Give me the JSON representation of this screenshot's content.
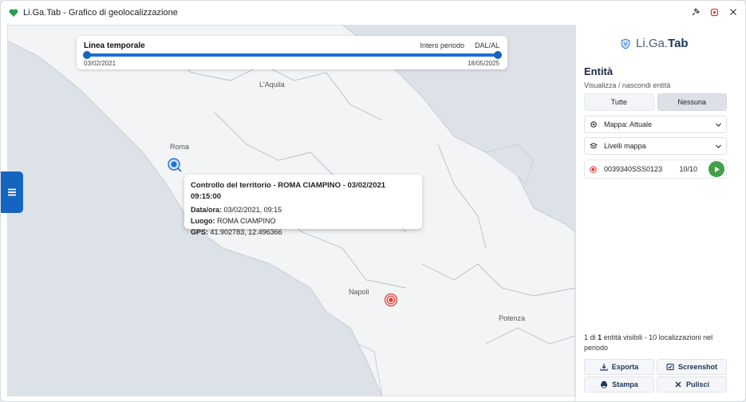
{
  "window": {
    "title": "Li.Ga.Tab - Grafico di geolocalizzazione"
  },
  "colors": {
    "accent": "#1565c0",
    "play": "#43a047",
    "marker_red": "#e53935",
    "map_bg": "#dfe3e8"
  },
  "timeline": {
    "title": "Linea temporale",
    "period_label": "Intero periodo",
    "range_label": "DAL/AL",
    "start_date": "03/02/2021",
    "end_date": "18/05/2025"
  },
  "map": {
    "cities": {
      "aquila": "L'Aquila",
      "roma": "Roma",
      "napoli": "Napoli",
      "potenza": "Potenza"
    },
    "popup": {
      "title": "Controllo del territorio - ROMA CIAMPINO - 03/02/2021 09:15:00",
      "date_label": "Data/ora:",
      "date_value": "03/02/2021, 09:15",
      "place_label": "Luogo:",
      "place_value": "ROMA CIAMPINO",
      "gps_label": "GPS:",
      "gps_value": "41.902783, 12.496366"
    }
  },
  "panel": {
    "logo_light": "Li.Ga.",
    "logo_bold": "Tab",
    "heading": "Entità",
    "subtitle": "Visualizza / nascondi entità",
    "btn_all": "Tutte",
    "btn_none": "Nessuna",
    "map_select": "Mappa: Attuale",
    "layers_select": "Livelli mappa",
    "entity": {
      "id": "0039340SSS0123",
      "count": "10/10"
    },
    "footer": {
      "visible_count": "1",
      "total_count": "1",
      "suffix": "entità visibili - 10 localizzazioni nel periodo",
      "prefix": "di"
    },
    "actions": {
      "export": "Esporta",
      "screenshot": "Screenshot",
      "print": "Stampa",
      "clear": "Pulisci"
    }
  }
}
